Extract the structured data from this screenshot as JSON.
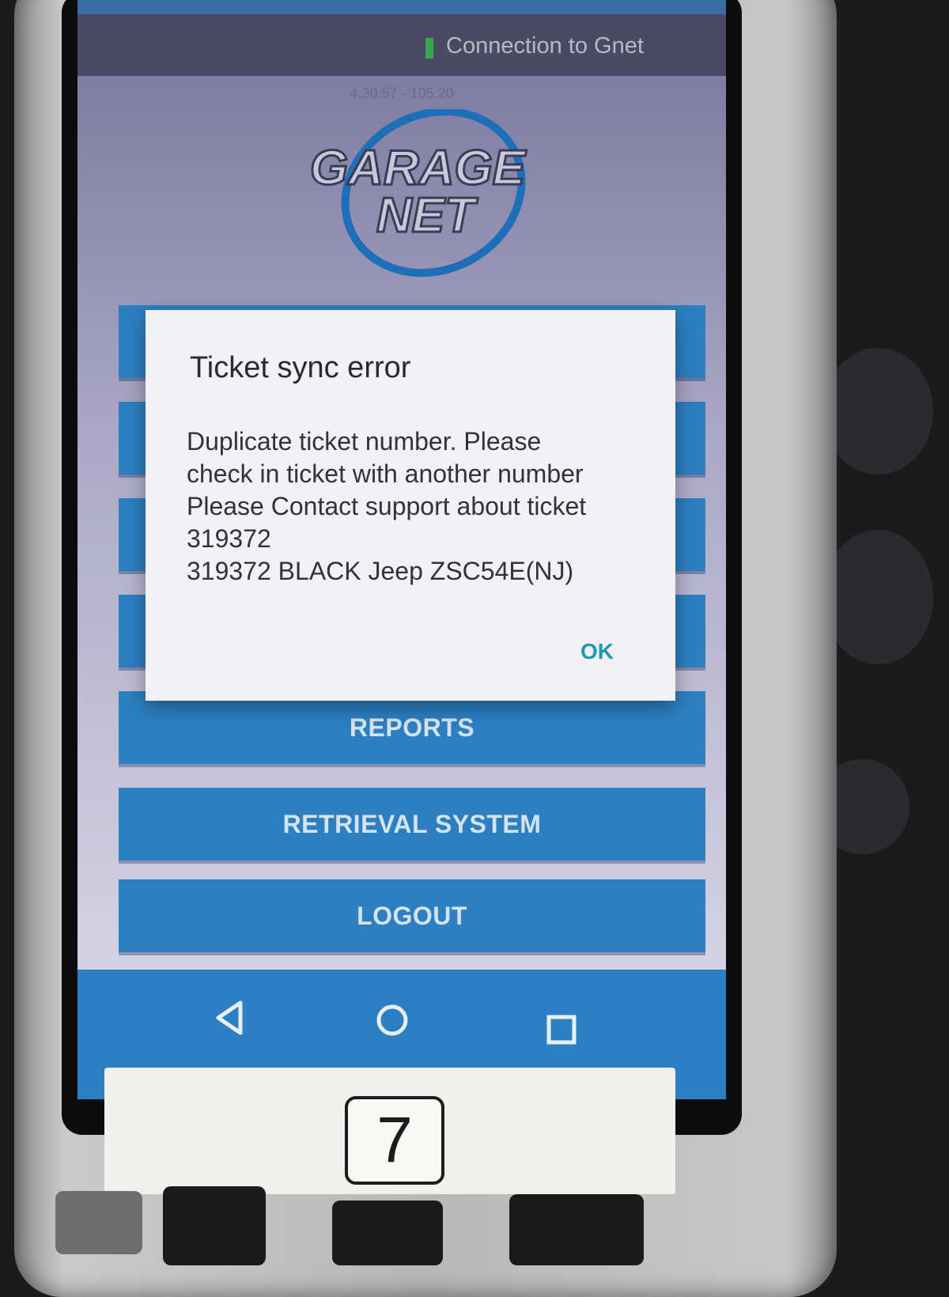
{
  "connection": {
    "text": "Connection to Gnet",
    "indicator_color": "#3aa84a"
  },
  "app": {
    "version": "4.30.57 - 105.20",
    "logo_line1": "GARAGE",
    "logo_line2": "NET"
  },
  "menu": {
    "buttons": [
      {
        "label": ""
      },
      {
        "label": ""
      },
      {
        "label": ""
      },
      {
        "label": ""
      },
      {
        "label": "REPORTS"
      },
      {
        "label": "RETRIEVAL SYSTEM"
      },
      {
        "label": "LOGOUT"
      }
    ],
    "color": "#2c7fc0"
  },
  "dialog": {
    "title": "Ticket sync error",
    "lines": [
      "Duplicate ticket number. Please",
      "check in ticket with another number",
      "Please Contact support about ticket",
      "319372",
      "319372 BLACK Jeep ZSC54E(NJ)"
    ],
    "ok_label": "OK"
  },
  "nav": {
    "back": "back-icon",
    "home": "home-icon",
    "recents": "recents-icon"
  },
  "device_label": "7"
}
